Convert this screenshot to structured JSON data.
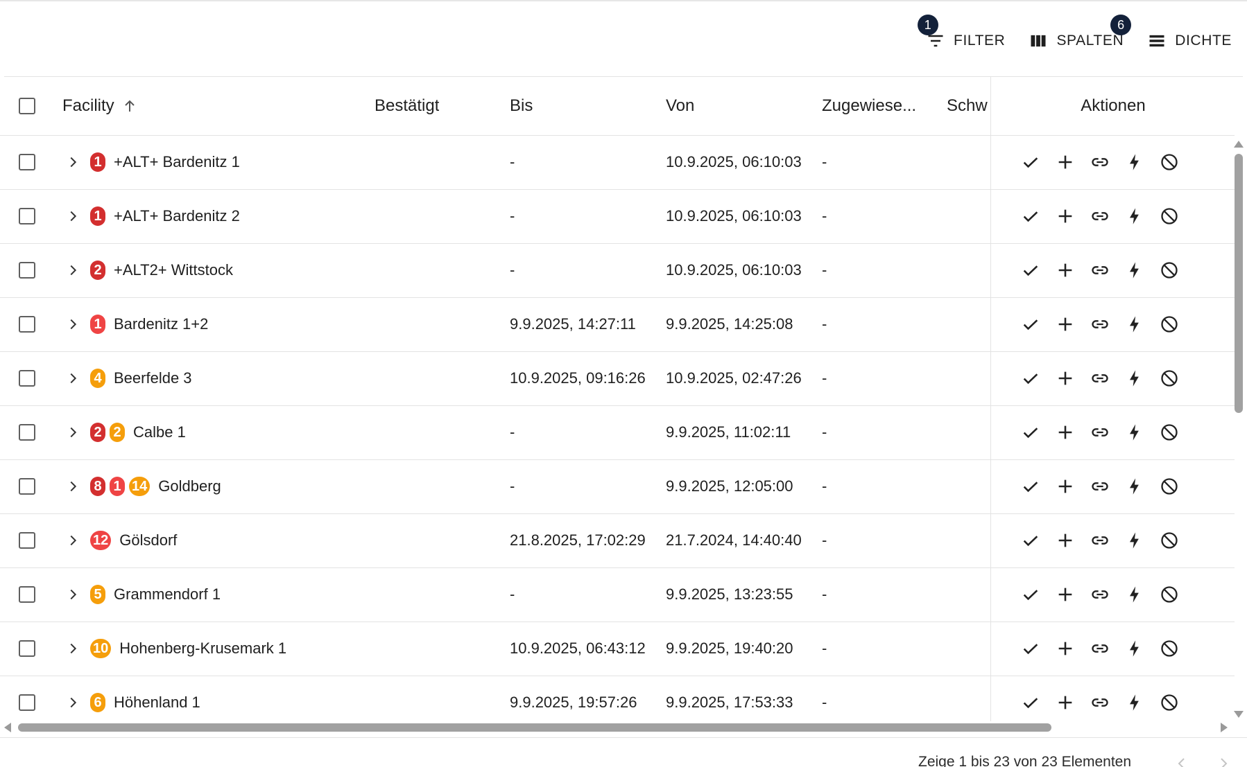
{
  "toolbar": {
    "filter_label": "Filter",
    "filter_badge": "1",
    "columns_label": "Spalten",
    "columns_badge": "6",
    "density_label": "Dichte"
  },
  "columns": {
    "facility": "Facility",
    "confirmed": "Bestätigt",
    "until": "Bis",
    "from": "Von",
    "assigned": "Zugewiese...",
    "severity": "Schw",
    "actions": "Aktionen"
  },
  "colors": {
    "badge_red": "#d32f2f",
    "badge_redlight": "#ef4444",
    "badge_orange": "#f59e0b"
  },
  "action_icons": [
    "check-icon",
    "plus-icon",
    "link-icon",
    "bolt-icon",
    "block-icon"
  ],
  "rows": [
    {
      "badges": [
        {
          "n": "1",
          "c": "red"
        }
      ],
      "name": "+ALT+ Bardenitz 1",
      "confirmed": "",
      "until": "-",
      "from": "10.9.2025, 06:10:03",
      "assigned": "-"
    },
    {
      "badges": [
        {
          "n": "1",
          "c": "red"
        }
      ],
      "name": "+ALT+ Bardenitz 2",
      "confirmed": "",
      "until": "-",
      "from": "10.9.2025, 06:10:03",
      "assigned": "-"
    },
    {
      "badges": [
        {
          "n": "2",
          "c": "red"
        }
      ],
      "name": "+ALT2+ Wittstock",
      "confirmed": "",
      "until": "-",
      "from": "10.9.2025, 06:10:03",
      "assigned": "-"
    },
    {
      "badges": [
        {
          "n": "1",
          "c": "redlight"
        }
      ],
      "name": "Bardenitz 1+2",
      "confirmed": "",
      "until": "9.9.2025, 14:27:11",
      "from": "9.9.2025, 14:25:08",
      "assigned": "-"
    },
    {
      "badges": [
        {
          "n": "4",
          "c": "orange"
        }
      ],
      "name": "Beerfelde 3",
      "confirmed": "",
      "until": "10.9.2025, 09:16:26",
      "from": "10.9.2025, 02:47:26",
      "assigned": "-"
    },
    {
      "badges": [
        {
          "n": "2",
          "c": "red"
        },
        {
          "n": "2",
          "c": "orange"
        }
      ],
      "name": "Calbe 1",
      "confirmed": "",
      "until": "-",
      "from": "9.9.2025, 11:02:11",
      "assigned": "-"
    },
    {
      "badges": [
        {
          "n": "8",
          "c": "red"
        },
        {
          "n": "1",
          "c": "redlight"
        },
        {
          "n": "14",
          "c": "orange"
        }
      ],
      "name": "Goldberg",
      "confirmed": "",
      "until": "-",
      "from": "9.9.2025, 12:05:00",
      "assigned": "-"
    },
    {
      "badges": [
        {
          "n": "12",
          "c": "redlight"
        }
      ],
      "name": "Gölsdorf",
      "confirmed": "",
      "until": "21.8.2025, 17:02:29",
      "from": "21.7.2024, 14:40:40",
      "assigned": "-"
    },
    {
      "badges": [
        {
          "n": "5",
          "c": "orange"
        }
      ],
      "name": "Grammendorf 1",
      "confirmed": "",
      "until": "-",
      "from": "9.9.2025, 13:23:55",
      "assigned": "-"
    },
    {
      "badges": [
        {
          "n": "10",
          "c": "orange"
        }
      ],
      "name": "Hohenberg-Krusemark 1",
      "confirmed": "",
      "until": "10.9.2025, 06:43:12",
      "from": "9.9.2025, 19:40:20",
      "assigned": "-"
    },
    {
      "badges": [
        {
          "n": "6",
          "c": "orange"
        }
      ],
      "name": "Höhenland 1",
      "confirmed": "",
      "until": "9.9.2025, 19:57:26",
      "from": "9.9.2025, 17:53:33",
      "assigned": "-"
    }
  ],
  "footer": {
    "summary": "Zeige 1 bis 23 von 23 Elementen"
  }
}
